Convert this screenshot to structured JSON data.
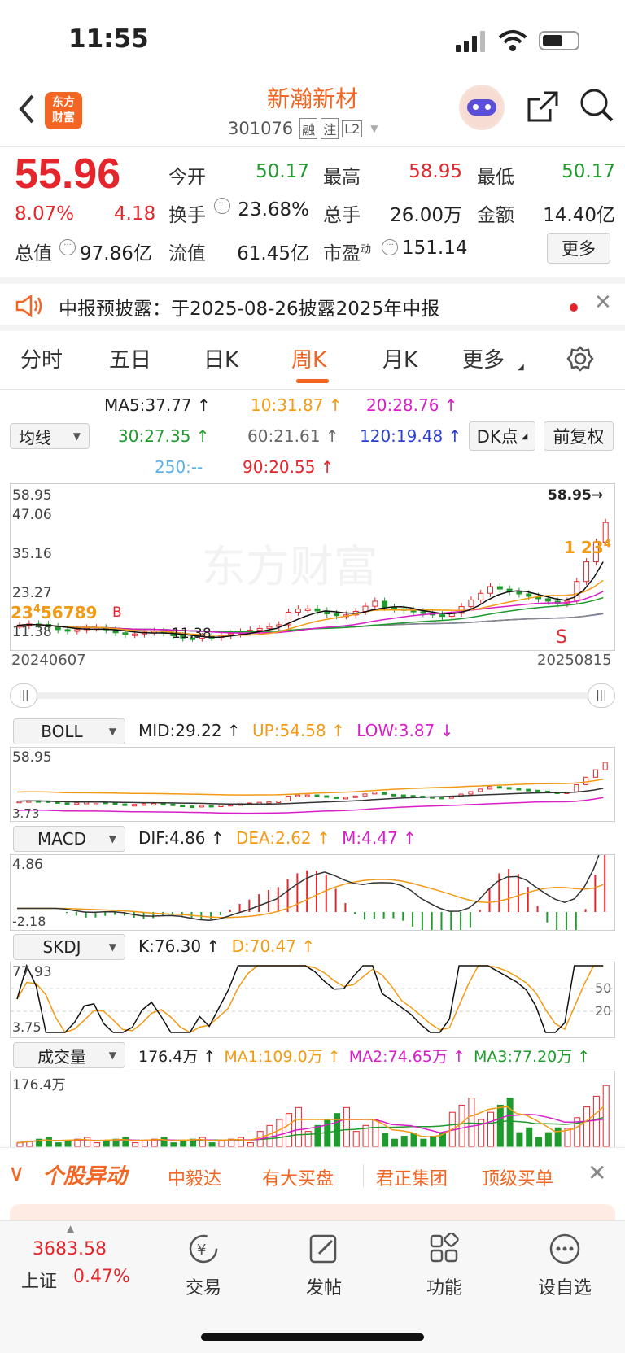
{
  "status_bar": {
    "time": "11:55"
  },
  "header": {
    "logo": "东方\n财富",
    "title": "新瀚新材",
    "code": "301076",
    "tags": [
      "融",
      "注",
      "L2"
    ]
  },
  "quote": {
    "price": "55.96",
    "change_pct": "8.07%",
    "change_amt": "4.18",
    "open_label": "今开",
    "open": "50.17",
    "high_label": "最高",
    "high": "58.95",
    "low_label": "最低",
    "low": "50.17",
    "turnover_label": "换手",
    "turnover": "23.68%",
    "volume_label": "总手",
    "volume": "26.00万",
    "amount_label": "金额",
    "amount": "14.40亿",
    "mktcap_label": "总值",
    "mktcap": "97.86亿",
    "float_label": "流值",
    "float_cap": "61.45亿",
    "pe_label": "市盈",
    "pe_sup": "动",
    "pe": "151.14",
    "more_label": "更多"
  },
  "notice": {
    "text": "中报预披露：于2025-08-26披露2025年中报"
  },
  "tabs": [
    "分时",
    "五日",
    "日K",
    "周K",
    "月K",
    "更多"
  ],
  "active_tab": "周K",
  "ma": {
    "ma5": "MA5:37.77",
    "ma10": "10:31.87",
    "ma20": "20:28.76",
    "ma30": "30:27.35",
    "ma60": "60:21.61",
    "ma120": "120:19.48",
    "ma250": "250:--",
    "ma90": "90:20.55",
    "selector": "均线",
    "dk": "DK点",
    "fq": "前复权"
  },
  "main_chart": {
    "y_labels": [
      "58.95",
      "47.06",
      "35.16",
      "23.27",
      "11.38"
    ],
    "high_mark": "58.95",
    "low_mark": "11.38",
    "date_start": "20240607",
    "date_end": "20250815",
    "watermark": "东方财富",
    "signal_s": "S",
    "signal_b": "B"
  },
  "boll": {
    "name": "BOLL",
    "mid": "MID:29.22",
    "up": "UP:54.58",
    "low": "LOW:3.87",
    "y_top": "58.95",
    "y_bot": "3.73"
  },
  "macd": {
    "name": "MACD",
    "dif": "DIF:4.86",
    "dea": "DEA:2.62",
    "m": "M:4.47",
    "y_top": "4.86",
    "y_bot": "-2.18"
  },
  "skdj": {
    "name": "SKDJ",
    "k": "K:76.30",
    "d": "D:70.47",
    "y_top": "77.93",
    "y_bot": "3.75",
    "l50": "50",
    "l20": "20"
  },
  "vol": {
    "name": "成交量",
    "v": "176.4万",
    "ma1": "MA1:109.0万",
    "ma2": "MA2:74.65万",
    "ma3": "MA3:77.20万",
    "y_top": "176.4万"
  },
  "news_bar": {
    "title": "个股异动",
    "items": [
      "中毅达",
      "有大买盘",
      "君正集团",
      "顶级买单"
    ]
  },
  "bottom_nav": {
    "index_value": "3683.58",
    "index_name": "上证",
    "index_pct": "0.47%",
    "items": [
      "交易",
      "发帖",
      "功能",
      "设自选"
    ]
  },
  "colors": {
    "up": "#e4262c",
    "down": "#1f9a2c",
    "accent": "#f26522"
  }
}
